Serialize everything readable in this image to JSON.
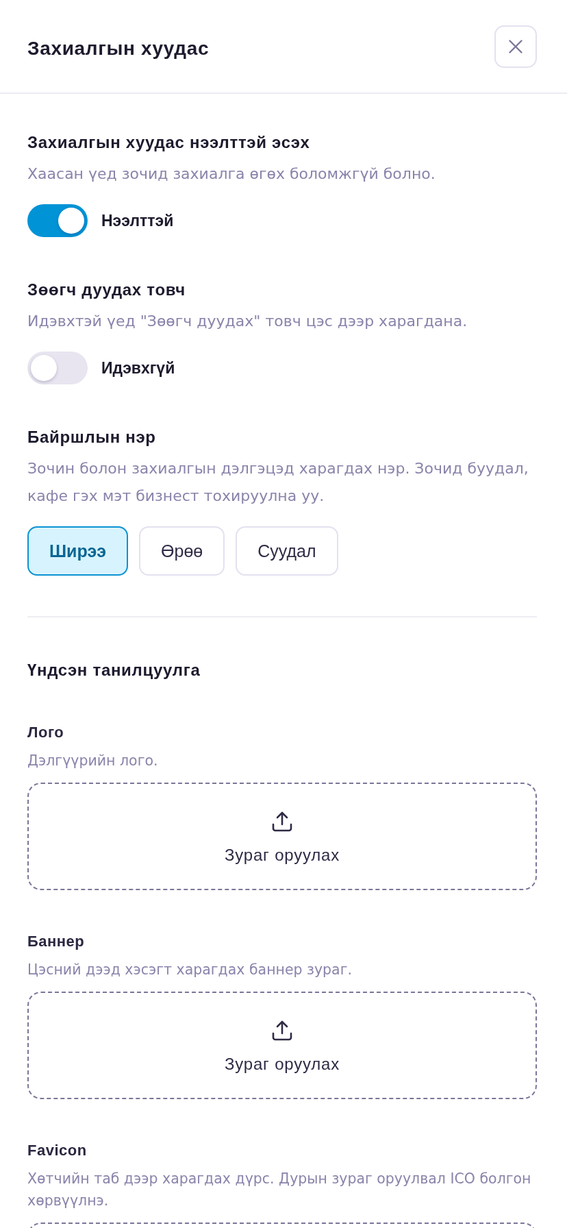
{
  "header": {
    "title": "Захиалгын хуудас"
  },
  "settings": [
    {
      "kind": "toggle",
      "title": "Захиалгын хуудас нээлттэй эсэх",
      "description": "Хаасан үед зочид захиалга өгөх боломжгүй болно.",
      "on": true,
      "state_label": "Нээлттэй"
    },
    {
      "kind": "toggle",
      "title": "Зөөгч дуудах товч",
      "description": "Идэвхтэй үед \"Зөөгч дуудах\" товч цэс дээр харагдана.",
      "on": false,
      "state_label": "Идэвхгүй"
    },
    {
      "kind": "choice",
      "title": "Байршлын нэр",
      "description": "Зочин болон захиалгын дэлгэцэд харагдах нэр. Зочид буудал, кафе гэх мэт бизнест тохируулна уу.",
      "options": [
        {
          "label": "Ширээ",
          "selected": true
        },
        {
          "label": "Өрөө",
          "selected": false
        },
        {
          "label": "Суудал",
          "selected": false
        }
      ]
    }
  ],
  "basic_info": {
    "title": "Үндсэн танилцуулга",
    "uploads": [
      {
        "label": "Лого",
        "description": "Дэлгүүрийн лого.",
        "button_text": "Зураг оруулах"
      },
      {
        "label": "Баннер",
        "description": "Цэсний дээд хэсэгт харагдах баннер зураг.",
        "button_text": "Зураг оруулах"
      },
      {
        "label": "Favicon",
        "description": "Хөтчийн таб дээр харагдах дүрс. Дурын зураг оруулвал ICO болгон хөрвүүлнэ."
      }
    ]
  }
}
